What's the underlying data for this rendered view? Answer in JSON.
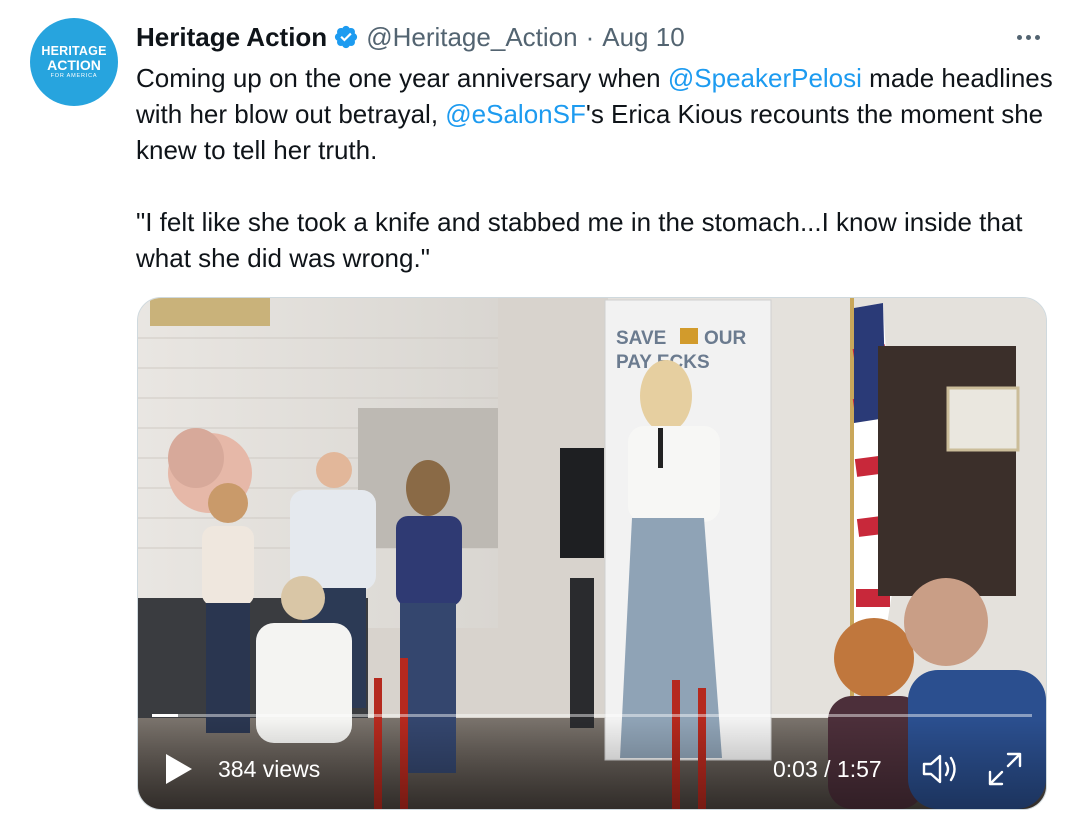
{
  "author": {
    "avatar_lines": [
      "HERITAGE",
      "ACTION",
      "FOR AMERICA"
    ],
    "name": "Heritage Action",
    "handle": "@Heritage_Action",
    "separator": "·",
    "date": "Aug 10",
    "verified_icon": "verified-badge-icon"
  },
  "tweet": {
    "segments_p1": [
      {
        "text": "Coming up on the one year anniversary when ",
        "mention": false
      },
      {
        "text": "@SpeakerPelosi",
        "mention": true
      },
      {
        "text": " made headlines with her blow out betrayal, ",
        "mention": false
      },
      {
        "text": "@eSalonSF",
        "mention": true
      },
      {
        "text": "'s Erica Kious recounts the moment she knew to tell her truth.",
        "mention": false
      }
    ],
    "paragraph2": "\"I felt like she took a knife and stabbed me in the stomach...I know inside that what she did was wrong.\""
  },
  "video": {
    "banner_line1": "SAVE",
    "banner_line1b": "OUR",
    "banner_line2": "PAY  ECKS",
    "views": "384 views",
    "time": "0:03 / 1:57",
    "progress": 0.03,
    "icons": [
      "play-icon",
      "volume-icon",
      "fullscreen-icon"
    ]
  },
  "colors": {
    "accent": "#1d9bf0",
    "avatar_bg": "#27a4de",
    "muted": "#536471"
  }
}
